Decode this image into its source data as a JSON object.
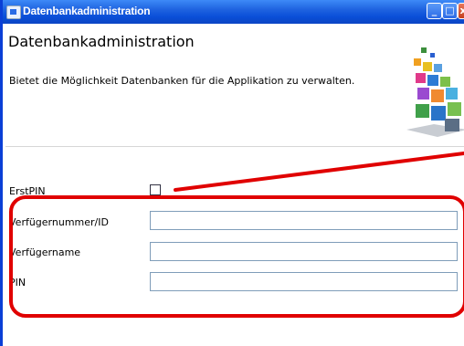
{
  "window": {
    "title": "Datenbankadministration",
    "controls": {
      "minimize": "_",
      "maximize": "□",
      "close": "x"
    }
  },
  "header": {
    "title": "Datenbankadministration",
    "subtitle": "Bietet die Möglichkeit Datenbanken für die Applikation zu verwalten."
  },
  "form": {
    "erstpin_label": "ErstPIN",
    "verfuegernummer_label": "Verfügernummer/ID",
    "verfuegernummer_value": "",
    "verfuegername_label": "Verfügername",
    "verfuegername_value": "",
    "pin_label": "PIN",
    "pin_value": "",
    "erstpin_checked": false
  },
  "colors": {
    "titlebar": "#0a4fd8",
    "annotation": "#e00000"
  }
}
